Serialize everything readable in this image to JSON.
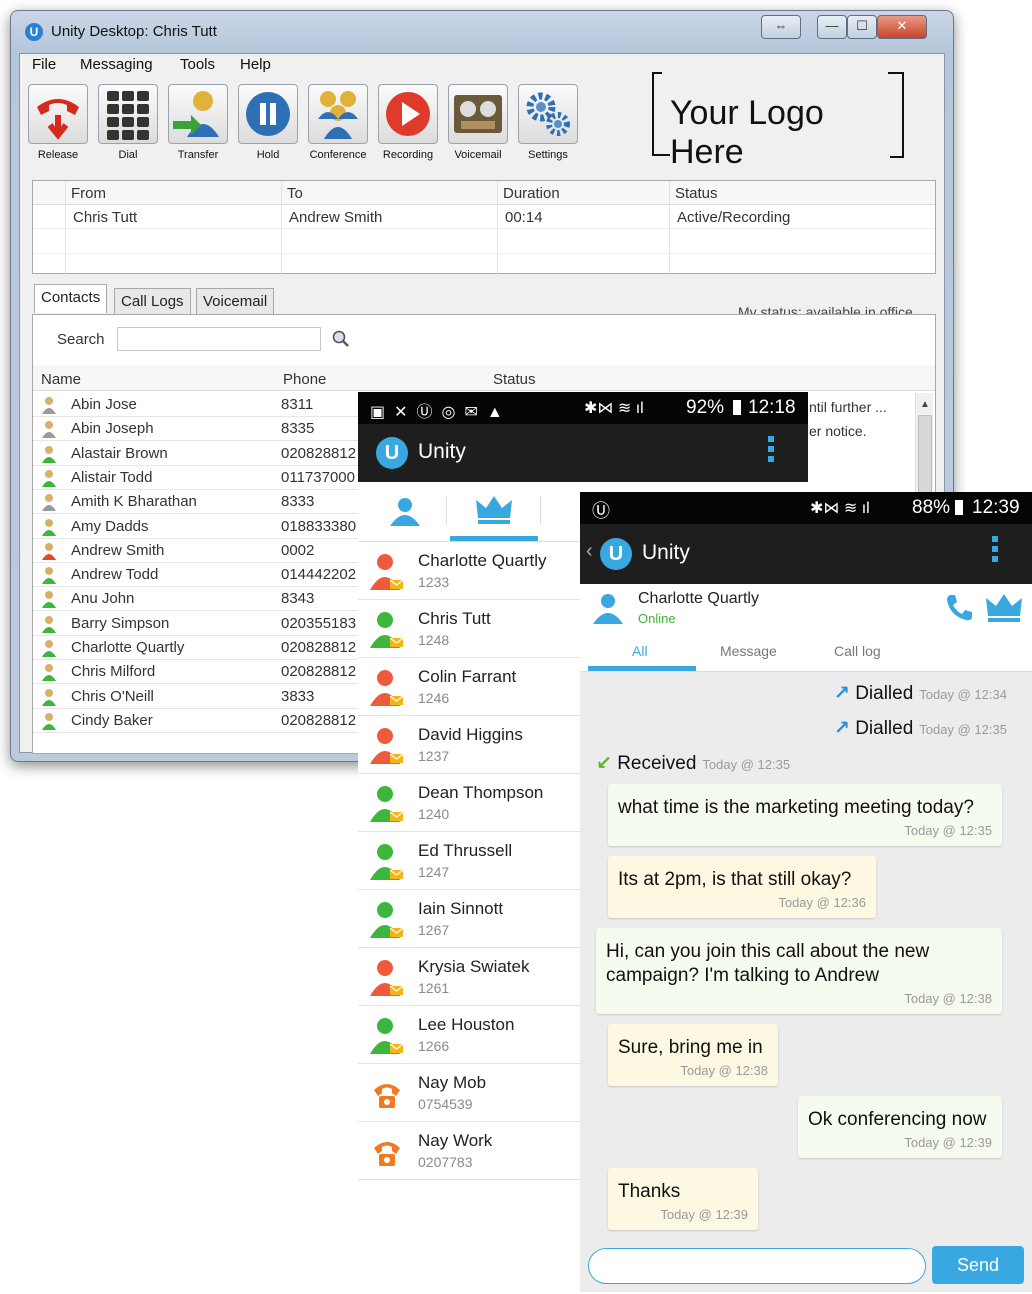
{
  "window": {
    "title": "Unity Desktop: Chris Tutt",
    "logo_letter": "U",
    "controls": [
      "⇔",
      "—",
      "☐",
      "✕"
    ]
  },
  "menu": [
    "File",
    "Messaging",
    "Tools",
    "Help"
  ],
  "toolbar": [
    {
      "label": "Release",
      "icon": "release-icon"
    },
    {
      "label": "Dial",
      "icon": "dialpad-icon"
    },
    {
      "label": "Transfer",
      "icon": "transfer-icon"
    },
    {
      "label": "Hold",
      "icon": "hold-icon"
    },
    {
      "label": "Conference",
      "icon": "conference-icon"
    },
    {
      "label": "Recording",
      "icon": "record-icon"
    },
    {
      "label": "Voicemail",
      "icon": "voicemail-icon"
    },
    {
      "label": "Settings",
      "icon": "settings-icon"
    }
  ],
  "logo_text": "Your Logo Here",
  "calls": {
    "headers": [
      "From",
      "To",
      "Duration",
      "Status"
    ],
    "rows": [
      {
        "from": "Chris Tutt",
        "to": "Andrew Smith",
        "duration": "00:14",
        "status": "Active/Recording"
      }
    ]
  },
  "tabs": [
    "Contacts",
    "Call Logs",
    "Voicemail"
  ],
  "my_status": "My status: available in office",
  "search_label": "Search",
  "contacts": {
    "headers": [
      "Name",
      "Phone",
      "Status"
    ],
    "status_fragments": [
      "ntil further ...",
      "er notice."
    ],
    "rows": [
      {
        "name": "Abin Jose",
        "phone": "8311",
        "state": "grey"
      },
      {
        "name": "Abin Joseph",
        "phone": "8335",
        "state": "grey"
      },
      {
        "name": "Alastair Brown",
        "phone": "020828812",
        "state": "green"
      },
      {
        "name": "Alistair Todd",
        "phone": "011737000",
        "state": "green"
      },
      {
        "name": "Amith K Bharathan",
        "phone": "8333",
        "state": "grey"
      },
      {
        "name": "Amy Dadds",
        "phone": "018833380",
        "state": "green"
      },
      {
        "name": "Andrew Smith",
        "phone": "0002",
        "state": "red"
      },
      {
        "name": "Andrew Todd",
        "phone": "014442202",
        "state": "green"
      },
      {
        "name": "Anu John",
        "phone": "8343",
        "state": "green"
      },
      {
        "name": "Barry Simpson",
        "phone": "020355183",
        "state": "green"
      },
      {
        "name": "Charlotte Quartly",
        "phone": "020828812",
        "state": "green"
      },
      {
        "name": "Chris Milford",
        "phone": "020828812",
        "state": "green"
      },
      {
        "name": "Chris O'Neill",
        "phone": "3833",
        "state": "green"
      },
      {
        "name": "Cindy Baker",
        "phone": "020828812",
        "state": "green"
      }
    ]
  },
  "phone1": {
    "battery": "92%",
    "time": "12:18",
    "app_title": "Unity",
    "contacts": [
      {
        "name": "Charlotte Quartly",
        "ext": "1233",
        "color": "red"
      },
      {
        "name": "Chris Tutt",
        "ext": "1248",
        "color": "green"
      },
      {
        "name": "Colin Farrant",
        "ext": "1246",
        "color": "red"
      },
      {
        "name": "David Higgins",
        "ext": "1237",
        "color": "red"
      },
      {
        "name": "Dean Thompson",
        "ext": "1240",
        "color": "green"
      },
      {
        "name": "Ed Thrussell",
        "ext": "1247",
        "color": "green"
      },
      {
        "name": "Iain Sinnott",
        "ext": "1267",
        "color": "green"
      },
      {
        "name": "Krysia Swiatek",
        "ext": "1261",
        "color": "red"
      },
      {
        "name": "Lee Houston",
        "ext": "1266",
        "color": "green"
      },
      {
        "name": "Nay Mob",
        "ext": "0754539",
        "color": "phone"
      },
      {
        "name": "Nay Work",
        "ext": "0207783",
        "color": "phone"
      }
    ]
  },
  "phone2": {
    "battery": "88%",
    "time": "12:39",
    "app_title": "Unity",
    "contact_name": "Charlotte Quartly",
    "contact_status": "Online",
    "tabs": [
      "All",
      "Message",
      "Call log"
    ],
    "events": [
      {
        "label": "Dialled",
        "time": "Today @ 12:34"
      },
      {
        "label": "Dialled",
        "time": "Today @ 12:35"
      },
      {
        "label": "Received",
        "time": "Today @ 12:35"
      }
    ],
    "messages": [
      {
        "text": "what time is the marketing meeting today?",
        "time": "Today @ 12:35"
      },
      {
        "text": "Its at 2pm, is that still okay?",
        "time": "Today @ 12:36"
      },
      {
        "text": "Hi, can you join this call about the new campaign? I'm talking to Andrew",
        "time": "Today @ 12:38"
      },
      {
        "text": "Sure, bring me in",
        "time": "Today @ 12:38"
      },
      {
        "text": "Ok conferencing now",
        "time": "Today @ 12:39"
      },
      {
        "text": "Thanks",
        "time": "Today @ 12:39"
      }
    ],
    "send_label": "Send"
  },
  "colors": {
    "accent": "#3aa8e0",
    "online_green": "#3cb63c",
    "busy_red": "#f05a3c",
    "dialled_arrow": "#2a8fd8",
    "received_arrow": "#5ab42a",
    "phone_orange": "#f07a24"
  }
}
